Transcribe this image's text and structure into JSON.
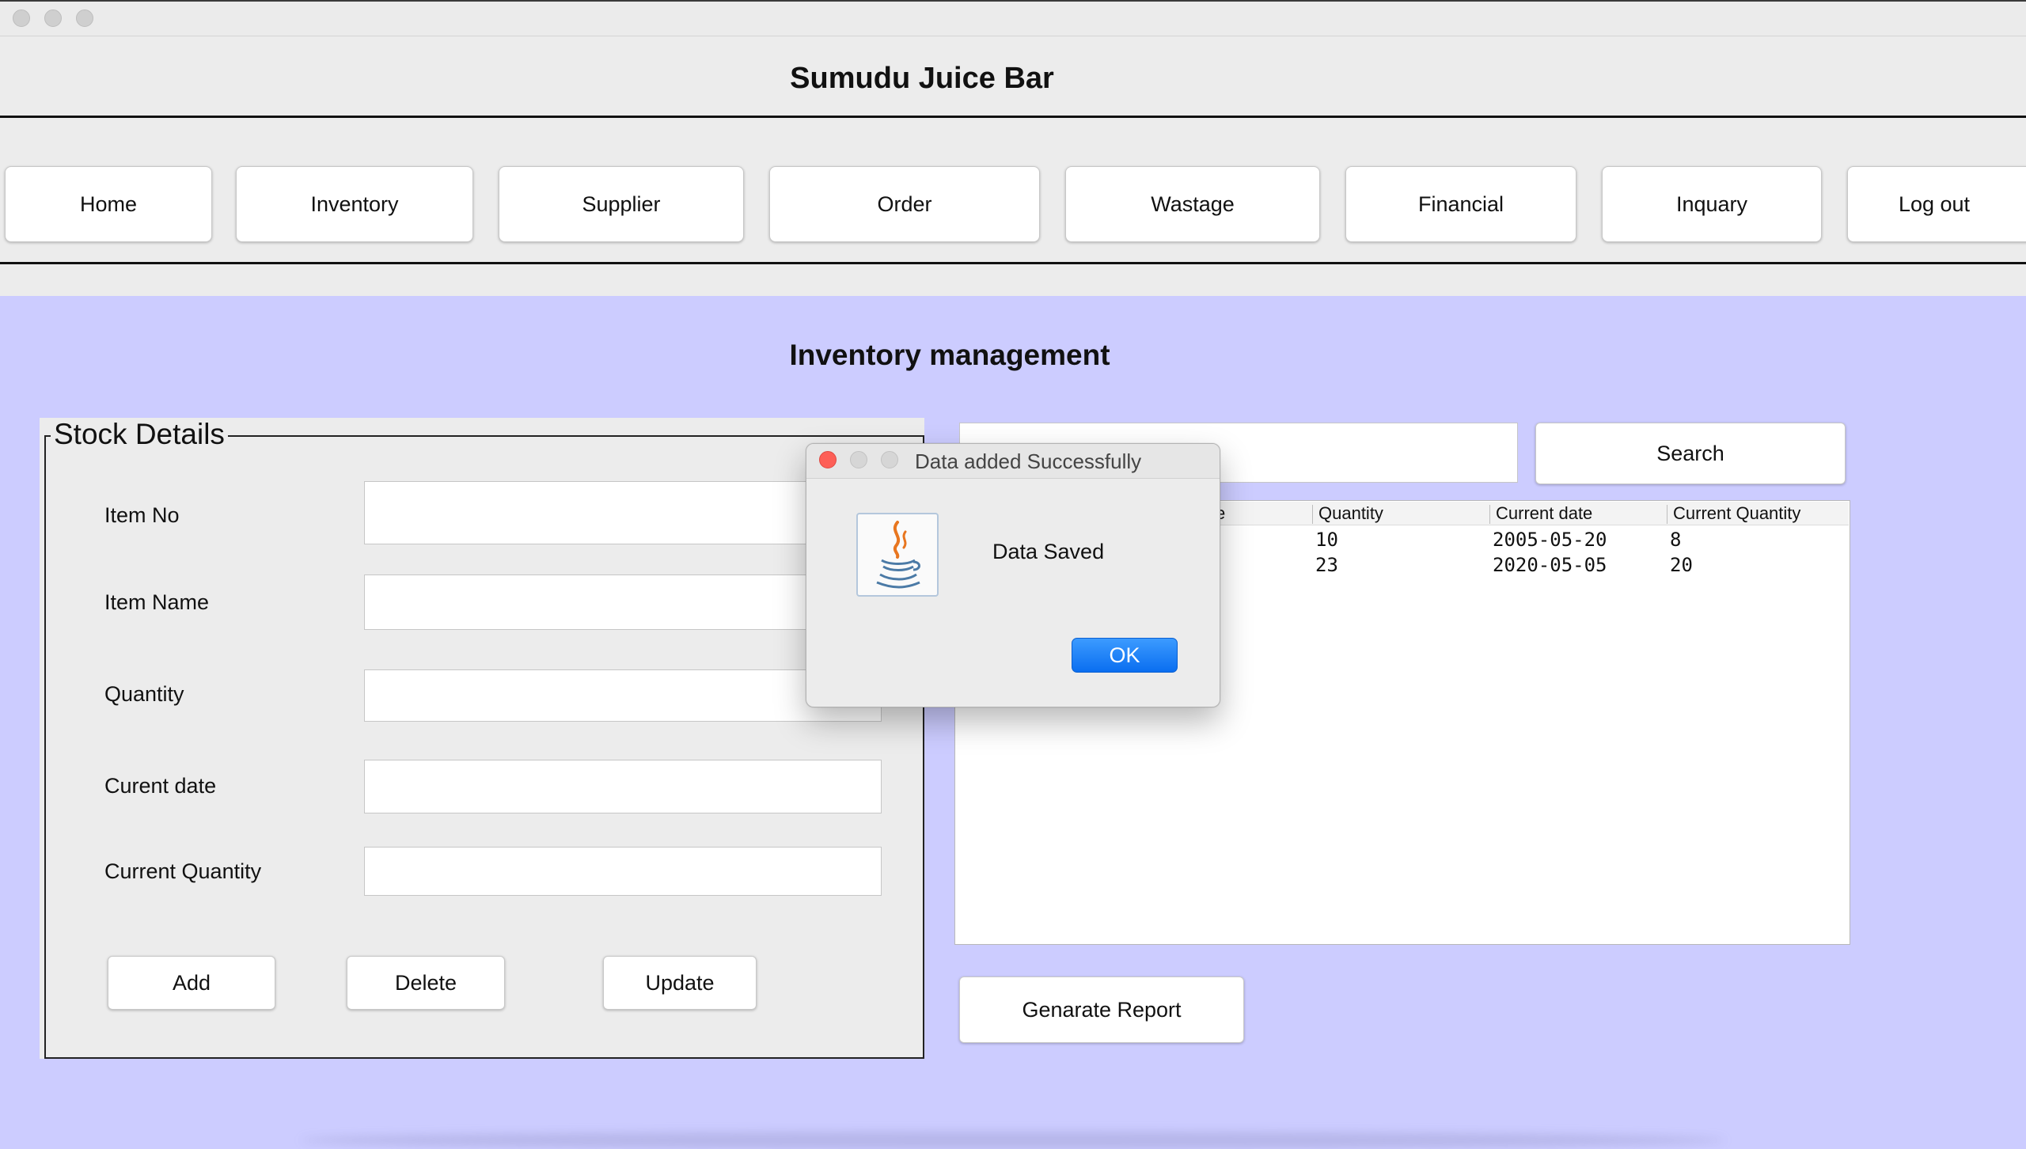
{
  "window": {
    "traffic_lights": [
      "close",
      "minimize",
      "zoom"
    ]
  },
  "app": {
    "title": "Sumudu Juice Bar"
  },
  "nav": {
    "items": [
      {
        "label": "Home"
      },
      {
        "label": "Inventory"
      },
      {
        "label": "Supplier"
      },
      {
        "label": "Order"
      },
      {
        "label": "Wastage"
      },
      {
        "label": "Financial"
      },
      {
        "label": "Inquary"
      },
      {
        "label": "Log out"
      }
    ]
  },
  "page": {
    "heading": "Inventory management"
  },
  "stock_details": {
    "legend": "Stock Details",
    "fields": [
      {
        "label": "Item No",
        "value": ""
      },
      {
        "label": "Item Name",
        "value": ""
      },
      {
        "label": "Quantity",
        "value": ""
      },
      {
        "label": "Curent date",
        "value": ""
      },
      {
        "label": "Current Quantity",
        "value": ""
      }
    ],
    "buttons": {
      "add": "Add",
      "delete": "Delete",
      "update": "Update"
    }
  },
  "search": {
    "value": "",
    "button_label": "Search"
  },
  "table": {
    "visible_header_fragment": "e",
    "columns": [
      "Quantity",
      "Current date",
      "Current Quantity"
    ],
    "rows": [
      {
        "quantity": "10",
        "current_date": "2005-05-20",
        "current_quantity": "8"
      },
      {
        "quantity": "23",
        "current_date": "2020-05-05",
        "current_quantity": "20"
      }
    ]
  },
  "report": {
    "button_label": "Genarate Report"
  },
  "dialog": {
    "title": "Data added Successfully",
    "message": "Data Saved",
    "ok_label": "OK",
    "icon": "java-icon",
    "colors": {
      "close_dot": "#fd5f57",
      "ok_button": "#1a7cf5"
    }
  },
  "colors": {
    "content_background": "#ccccff",
    "chrome_background": "#ececec"
  }
}
